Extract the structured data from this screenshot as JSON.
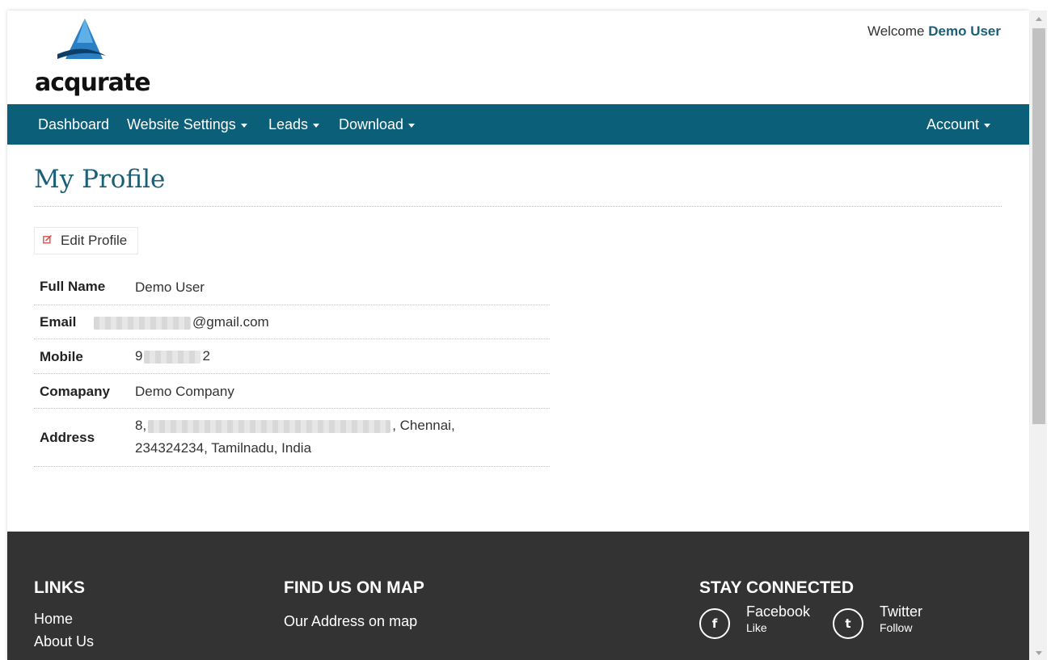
{
  "header": {
    "logo_text": "acqurate",
    "welcome_prefix": "Welcome",
    "welcome_user": "Demo User"
  },
  "nav": {
    "items": [
      {
        "label": "Dashboard",
        "dropdown": false
      },
      {
        "label": "Website Settings",
        "dropdown": true
      },
      {
        "label": "Leads",
        "dropdown": true
      },
      {
        "label": "Download",
        "dropdown": true
      }
    ],
    "account": {
      "label": "Account",
      "dropdown": true
    }
  },
  "main": {
    "title": "My Profile",
    "edit_button": "Edit Profile",
    "profile": {
      "full_name": {
        "label": "Full Name",
        "value": "Demo User"
      },
      "email": {
        "label": "Email",
        "value_suffix": "@gmail.com"
      },
      "mobile": {
        "label": "Mobile",
        "value_start": "9",
        "value_end": "2"
      },
      "company": {
        "label": "Comapany",
        "value": "Demo Company"
      },
      "address": {
        "label": "Address",
        "line1_start": "8,",
        "line1_end": ", Chennai,",
        "line2": "234324234, Tamilnadu, India"
      }
    }
  },
  "footer": {
    "links_heading": "LINKS",
    "links": [
      "Home",
      "About Us"
    ],
    "map_heading": "FIND US ON MAP",
    "map_text": "Our Address on map",
    "connect_heading": "STAY CONNECTED",
    "social": [
      {
        "icon": "facebook-icon",
        "glyph": "f",
        "name": "Facebook",
        "sub": "Like"
      },
      {
        "icon": "twitter-icon",
        "glyph": "t",
        "name": "Twitter",
        "sub": "Follow"
      }
    ]
  },
  "colors": {
    "nav_bg": "#0c5f78",
    "accent": "#1a5f78",
    "footer_bg": "#333333",
    "logo_blue": "#2a7fc4"
  }
}
